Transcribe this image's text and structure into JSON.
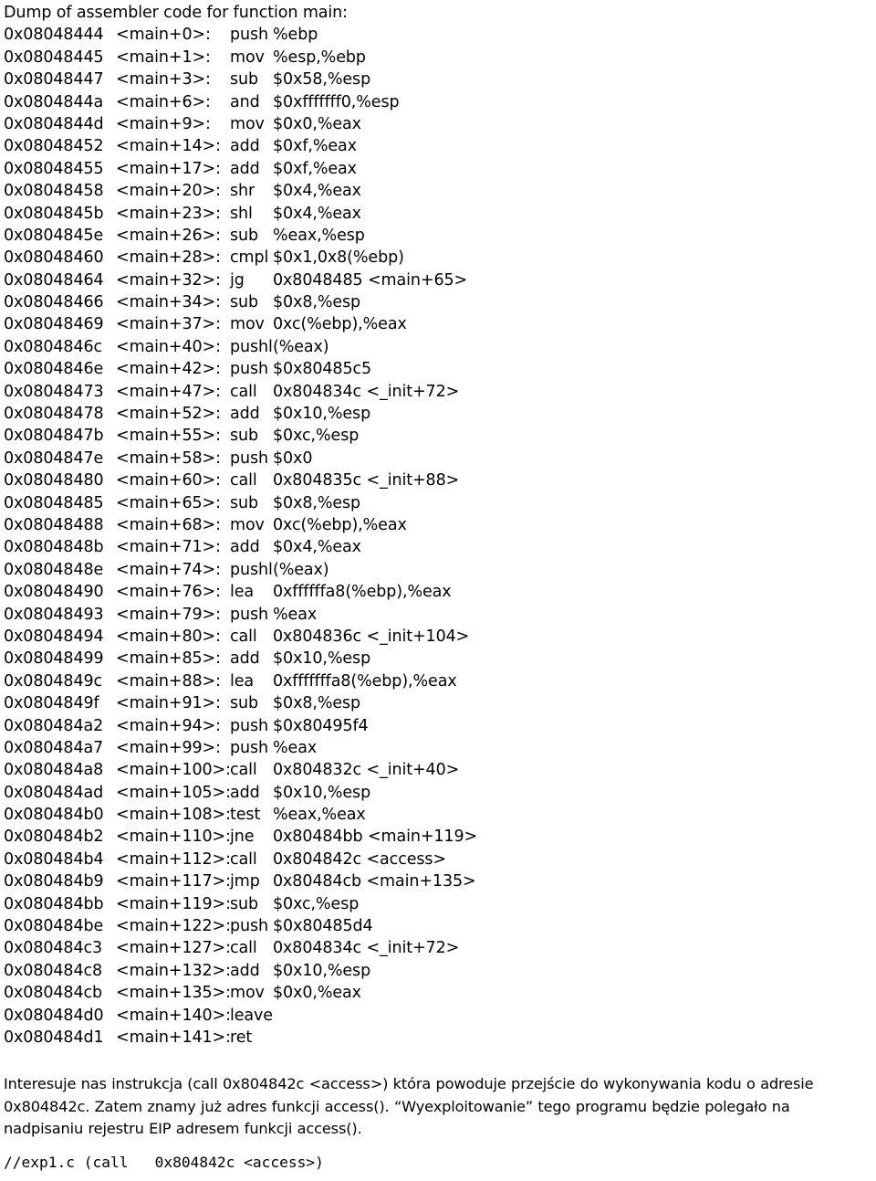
{
  "document": {
    "header": "Dump of assembler code for function main:",
    "disassembly": [
      {
        "address": "0x08048444",
        "symbol": "<main+0>:",
        "mnemonic": "push",
        "operands": "%ebp"
      },
      {
        "address": "0x08048445",
        "symbol": "<main+1>:",
        "mnemonic": "mov",
        "operands": "%esp,%ebp"
      },
      {
        "address": "0x08048447",
        "symbol": "<main+3>:",
        "mnemonic": "sub",
        "operands": "$0x58,%esp"
      },
      {
        "address": "0x0804844a",
        "symbol": "<main+6>:",
        "mnemonic": "and",
        "operands": "$0xfffffff0,%esp"
      },
      {
        "address": "0x0804844d",
        "symbol": "<main+9>:",
        "mnemonic": "mov",
        "operands": "$0x0,%eax"
      },
      {
        "address": "0x08048452",
        "symbol": "<main+14>:",
        "mnemonic": "add",
        "operands": "$0xf,%eax"
      },
      {
        "address": "0x08048455",
        "symbol": "<main+17>:",
        "mnemonic": "add",
        "operands": "$0xf,%eax"
      },
      {
        "address": "0x08048458",
        "symbol": "<main+20>:",
        "mnemonic": "shr",
        "operands": "$0x4,%eax"
      },
      {
        "address": "0x0804845b",
        "symbol": "<main+23>:",
        "mnemonic": "shl",
        "operands": "$0x4,%eax"
      },
      {
        "address": "0x0804845e",
        "symbol": "<main+26>:",
        "mnemonic": "sub",
        "operands": "%eax,%esp"
      },
      {
        "address": "0x08048460",
        "symbol": "<main+28>:",
        "mnemonic": "cmpl",
        "operands": "$0x1,0x8(%ebp)"
      },
      {
        "address": "0x08048464",
        "symbol": "<main+32>:",
        "mnemonic": "jg",
        "operands": "0x8048485 <main+65>"
      },
      {
        "address": "0x08048466",
        "symbol": "<main+34>:",
        "mnemonic": "sub",
        "operands": "$0x8,%esp"
      },
      {
        "address": "0x08048469",
        "symbol": "<main+37>:",
        "mnemonic": "mov",
        "operands": "0xc(%ebp),%eax"
      },
      {
        "address": "0x0804846c",
        "symbol": "<main+40>:",
        "mnemonic": "pushl",
        "operands": "(%eax)"
      },
      {
        "address": "0x0804846e",
        "symbol": "<main+42>:",
        "mnemonic": "push",
        "operands": "$0x80485c5"
      },
      {
        "address": "0x08048473",
        "symbol": "<main+47>:",
        "mnemonic": "call",
        "operands": "0x804834c <_init+72>"
      },
      {
        "address": "0x08048478",
        "symbol": "<main+52>:",
        "mnemonic": "add",
        "operands": "$0x10,%esp"
      },
      {
        "address": "0x0804847b",
        "symbol": "<main+55>:",
        "mnemonic": "sub",
        "operands": "$0xc,%esp"
      },
      {
        "address": "0x0804847e",
        "symbol": "<main+58>:",
        "mnemonic": "push",
        "operands": "$0x0"
      },
      {
        "address": "0x08048480",
        "symbol": "<main+60>:",
        "mnemonic": "call",
        "operands": "0x804835c <_init+88>"
      },
      {
        "address": "0x08048485",
        "symbol": "<main+65>:",
        "mnemonic": "sub",
        "operands": "$0x8,%esp"
      },
      {
        "address": "0x08048488",
        "symbol": "<main+68>:",
        "mnemonic": "mov",
        "operands": "0xc(%ebp),%eax"
      },
      {
        "address": "0x0804848b",
        "symbol": "<main+71>:",
        "mnemonic": "add",
        "operands": "$0x4,%eax"
      },
      {
        "address": "0x0804848e",
        "symbol": "<main+74>:",
        "mnemonic": "pushl",
        "operands": "(%eax)"
      },
      {
        "address": "0x08048490",
        "symbol": "<main+76>:",
        "mnemonic": "lea",
        "operands": "0xffffffa8(%ebp),%eax"
      },
      {
        "address": "0x08048493",
        "symbol": "<main+79>:",
        "mnemonic": "push",
        "operands": "%eax"
      },
      {
        "address": "0x08048494",
        "symbol": "<main+80>:",
        "mnemonic": "call",
        "operands": "0x804836c <_init+104>"
      },
      {
        "address": "0x08048499",
        "symbol": "<main+85>:",
        "mnemonic": "add",
        "operands": "$0x10,%esp"
      },
      {
        "address": "0x0804849c",
        "symbol": "<main+88>:",
        "mnemonic": "lea",
        "operands": "0xfffffffa8(%ebp),%eax"
      },
      {
        "address": "0x0804849f",
        "symbol": "<main+91>:",
        "mnemonic": "sub",
        "operands": "$0x8,%esp"
      },
      {
        "address": "0x080484a2",
        "symbol": "<main+94>:",
        "mnemonic": "push",
        "operands": "$0x80495f4"
      },
      {
        "address": "0x080484a7",
        "symbol": "<main+99>:",
        "mnemonic": "push",
        "operands": "%eax"
      },
      {
        "address": "0x080484a8",
        "symbol": "<main+100>:",
        "mnemonic": "call",
        "operands": "0x804832c <_init+40>"
      },
      {
        "address": "0x080484ad",
        "symbol": "<main+105>:",
        "mnemonic": "add",
        "operands": "$0x10,%esp"
      },
      {
        "address": "0x080484b0",
        "symbol": "<main+108>:",
        "mnemonic": "test",
        "operands": "%eax,%eax"
      },
      {
        "address": "0x080484b2",
        "symbol": "<main+110>:",
        "mnemonic": "jne",
        "operands": "0x80484bb <main+119>"
      },
      {
        "address": "0x080484b4",
        "symbol": "<main+112>:",
        "mnemonic": "call",
        "operands": "0x804842c <access>"
      },
      {
        "address": "0x080484b9",
        "symbol": "<main+117>:",
        "mnemonic": "jmp",
        "operands": "0x80484cb <main+135>"
      },
      {
        "address": "0x080484bb",
        "symbol": "<main+119>:",
        "mnemonic": "sub",
        "operands": "$0xc,%esp"
      },
      {
        "address": "0x080484be",
        "symbol": "<main+122>:",
        "mnemonic": "push",
        "operands": "$0x80485d4"
      },
      {
        "address": "0x080484c3",
        "symbol": "<main+127>:",
        "mnemonic": "call",
        "operands": "0x804834c <_init+72>"
      },
      {
        "address": "0x080484c8",
        "symbol": "<main+132>:",
        "mnemonic": "add",
        "operands": "$0x10,%esp"
      },
      {
        "address": "0x080484cb",
        "symbol": "<main+135>:",
        "mnemonic": "mov",
        "operands": "$0x0,%eax"
      },
      {
        "address": "0x080484d0",
        "symbol": "<main+140>:",
        "mnemonic": "leave",
        "operands": ""
      },
      {
        "address": "0x080484d1",
        "symbol": "<main+141>:",
        "mnemonic": "ret",
        "operands": ""
      }
    ],
    "prose": "Interesuje nas instrukcja (call   0x804842c <access>) która powoduje przejście do wykonywania kodu o adresie 0x804842c. Zatem znamy już adres funkcji access(). “Wyexploitowanie” tego programu będzie polegało na nadpisaniu rejestru EIP adresem funkcji access().",
    "code_comment": "//exp1.c (call   0x804842c <access>)"
  }
}
